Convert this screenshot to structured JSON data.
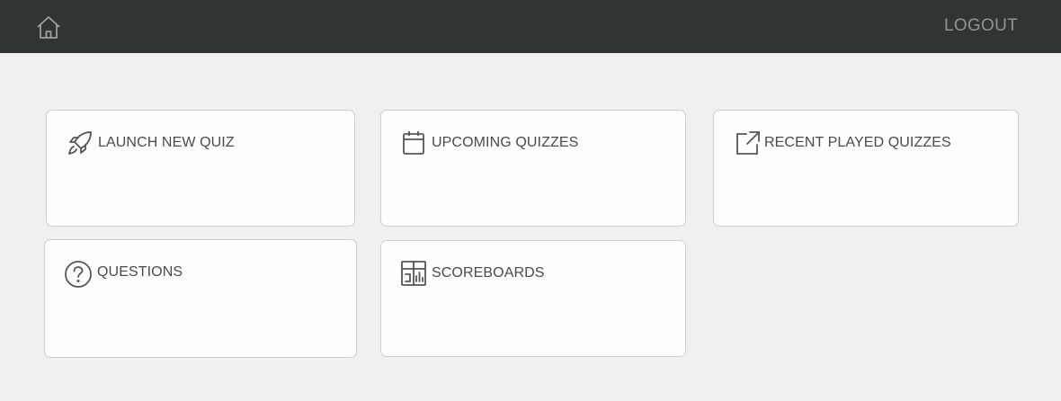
{
  "topbar": {
    "home_icon": "home-icon",
    "logout_label": "LOGOUT",
    "background": "#2f3632"
  },
  "cards": [
    {
      "id": "launch-new-quiz",
      "label": "LAUNCH NEW QUIZ",
      "icon": "rocket-icon"
    },
    {
      "id": "upcoming-quizzes",
      "label": "UPCOMING QUIZZES",
      "icon": "calendar-icon"
    },
    {
      "id": "recent-played-quizzes",
      "label": "RECENT PLAYED QUIZZES",
      "icon": "external-link-icon"
    },
    {
      "id": "questions",
      "label": "QUESTIONS",
      "icon": "question-circle-icon"
    },
    {
      "id": "scoreboards",
      "label": "SCOREBOARDS",
      "icon": "scoreboard-icon"
    }
  ]
}
